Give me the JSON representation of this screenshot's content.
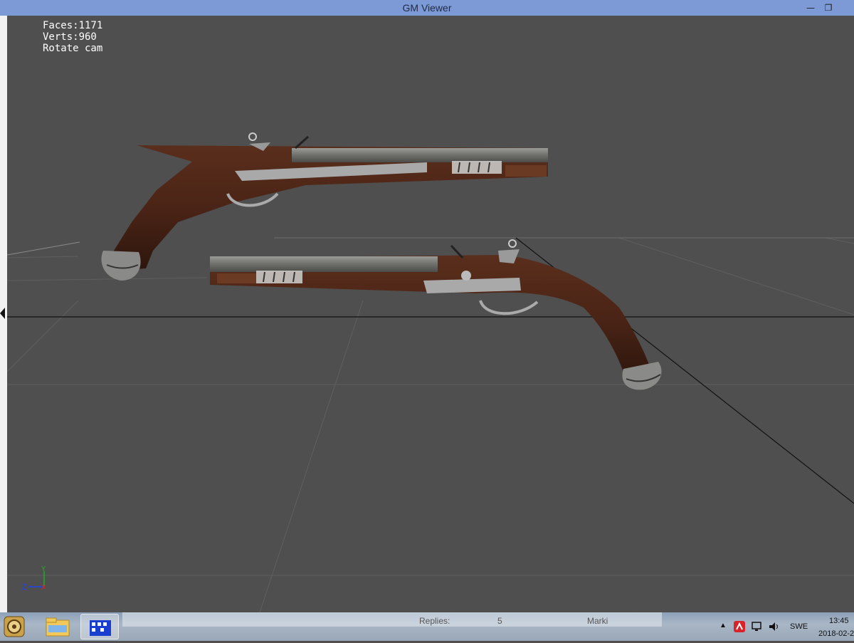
{
  "window": {
    "title": "GM Viewer",
    "minimize_glyph": "—",
    "restore_glyph": "❐"
  },
  "viewport": {
    "stats": {
      "faces": "Faces:1171",
      "verts": "Verts:960",
      "mode": "Rotate cam"
    },
    "axis_labels": {
      "y": "Y",
      "z": "Z",
      "x": "X"
    },
    "model": "flintlock-pistol-pair",
    "colors": {
      "background": "#4f4f4f",
      "stock": "#4a2416",
      "metal": "#8c8c8c",
      "grid": "#5c5c5c"
    }
  },
  "taskbar": {
    "apps": [
      {
        "name": "start-orb-icon"
      },
      {
        "name": "file-explorer-icon"
      },
      {
        "name": "gm-viewer-icon",
        "active": true
      }
    ],
    "background_window": {
      "replies_label": "Replies:",
      "replies_value": "5",
      "mark_label": "Marki"
    },
    "tray": {
      "language": "SWE",
      "time": "13:45",
      "date": "2018-02-2"
    }
  }
}
